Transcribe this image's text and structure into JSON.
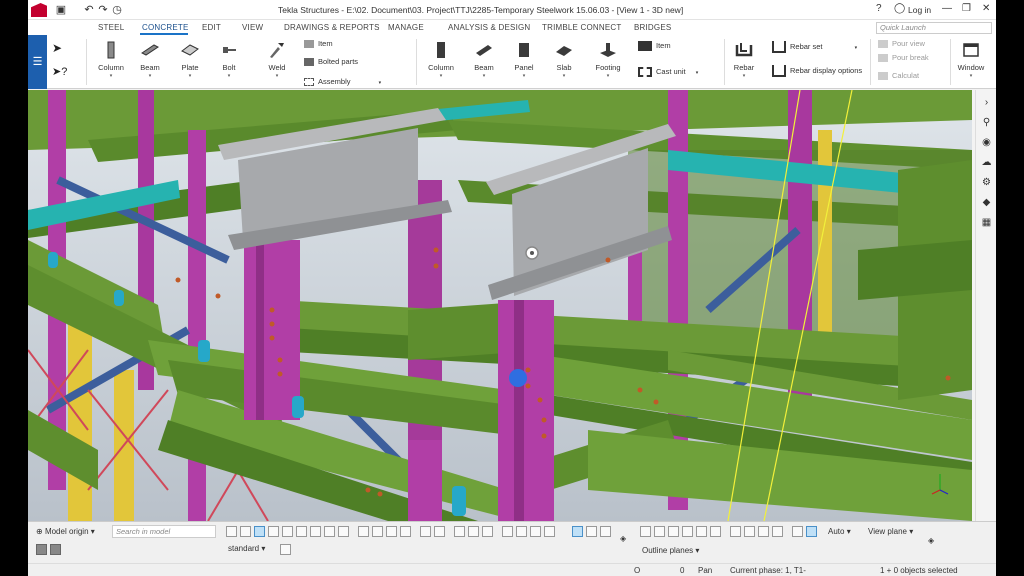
{
  "app": {
    "title": "Tekla Structures - E:\\02. Document\\03. Project\\TTJ\\2285-Temporary Steelwork  15.06.03 - [View 1 - 3D new]",
    "login_label": "Log in",
    "quick_launch_placeholder": "Quick Launch"
  },
  "tabs": [
    "STEEL",
    "CONCRETE",
    "EDIT",
    "VIEW",
    "DRAWINGS & REPORTS",
    "MANAGE",
    "ANALYSIS & DESIGN",
    "TRIMBLE CONNECT",
    "BRIDGES"
  ],
  "active_tab": "CONCRETE",
  "ribbon": {
    "steel_buttons": [
      "Column",
      "Beam",
      "Plate",
      "Bolt",
      "Weld"
    ],
    "steel_small": [
      "Item",
      "Bolted parts",
      "Assembly"
    ],
    "concrete_buttons": [
      "Column",
      "Beam",
      "Panel",
      "Slab",
      "Footing"
    ],
    "concrete_small": [
      "Item",
      "Cast unit"
    ],
    "rebar_button": "Rebar",
    "rebar_small": [
      "Rebar set",
      "Rebar display options"
    ],
    "pour_small": [
      "Pour view",
      "Pour break",
      "Calculat"
    ],
    "window_button": "Window"
  },
  "bottom": {
    "model_origin": "Model origin",
    "search_placeholder": "Search in model",
    "standard": "standard",
    "auto": "Auto",
    "view_plane": "View plane",
    "outline_planes": "Outline planes"
  },
  "status": {
    "o_label": "O",
    "zero": "0",
    "pan": "Pan",
    "phase": "Current phase: 1, T1-",
    "selection": "1 + 0 objects selected"
  },
  "colors": {
    "steel_green": "#5e8e2e",
    "column_magenta": "#b13ea6",
    "beam_grey": "#a7a9ac",
    "brace_blue": "#3c5e9c",
    "brace_teal": "#26b3b0",
    "column_yellow": "#e2c63a",
    "ribbon_blue": "#1d5fae"
  }
}
